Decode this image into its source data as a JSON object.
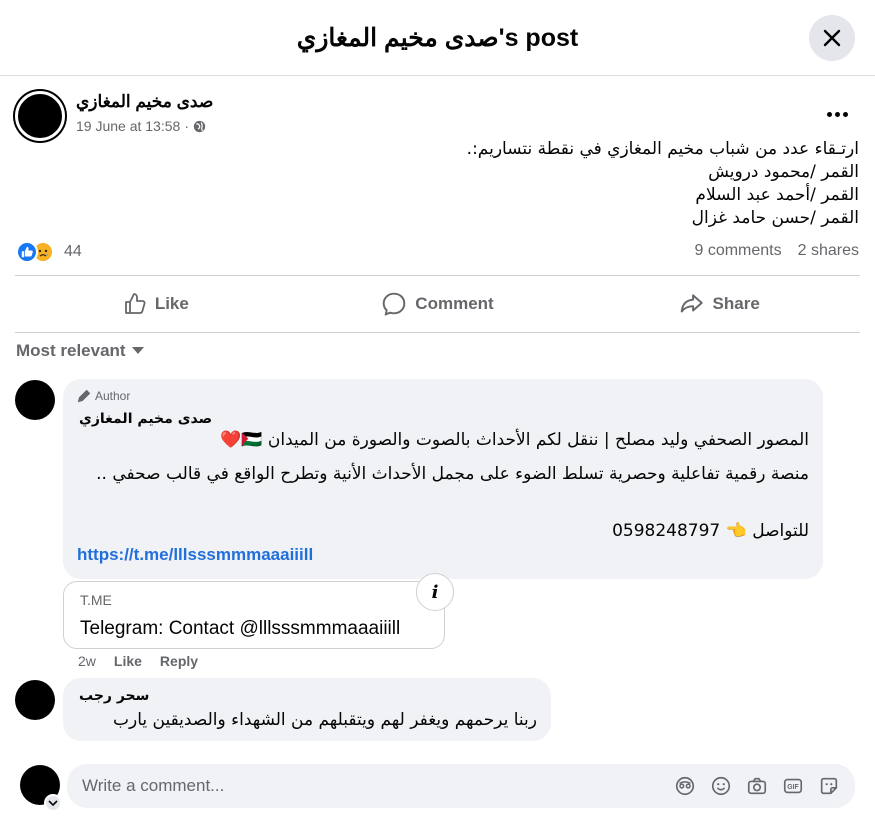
{
  "dialog": {
    "title": "صدى مخيم المغازي's post"
  },
  "post": {
    "author": "صدى مخيم المغازي",
    "timestamp": "19 June at 13:58",
    "dot": "·",
    "body_lines": [
      "ارتـقاء عدد من شباب مخيم المغازي في نقطة نتساريم:.",
      "القمر /محمود درويش",
      "القمر /أحمد عبد السلام",
      "القمر /حسن حامد غزال"
    ],
    "reaction_count": "44",
    "comments_count": "9 comments",
    "shares_count": "2 shares"
  },
  "actions": {
    "like": "Like",
    "comment": "Comment",
    "share": "Share"
  },
  "sort": {
    "label": "Most relevant"
  },
  "comments": [
    {
      "badge": "Author",
      "name": "صدى مخيم المغازي",
      "line1": "المصور الصحفي وليد مصلح | ننقل لكم الأحداث بالصوت والصورة من الميدان 🇵🇸❤️",
      "line2": "منصة رقمية تفاعلية وحصرية تسلط الضوء على مجمل الأحداث الأنية وتطرح الواقع في قالب صحفي ..",
      "line3": "للتواصل 👈 0598248797",
      "link": "https://t.me/lllsssmmmaaaiiill",
      "preview_domain": "T.ME",
      "preview_title": "Telegram: Contact @lllsssmmmaaaiiill",
      "age": "2w",
      "like": "Like",
      "reply": "Reply"
    },
    {
      "name": "سحر رجب",
      "text": "ربنا يرحمهم ويغفر لهم ويتقبلهم من الشهداء والصديقين يارب"
    }
  ],
  "composer": {
    "placeholder": "Write a comment..."
  },
  "colors": {
    "accent": "#1877f2",
    "link": "#216fdb",
    "secondary_text": "#65676b",
    "bubble": "#f0f2f5"
  }
}
